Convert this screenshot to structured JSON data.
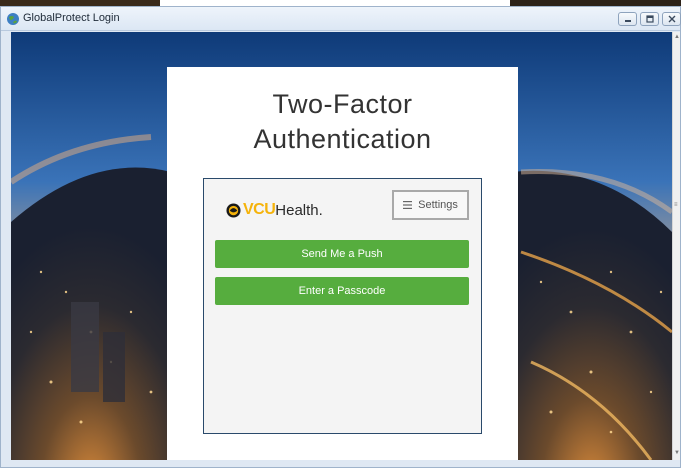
{
  "window": {
    "title": "GlobalProtect Login",
    "app_icon": "globe-icon",
    "controls": [
      "minimize-icon",
      "maximize-icon",
      "close-icon"
    ]
  },
  "login": {
    "heading_line1": "Two-Factor",
    "heading_line2": "Authentication"
  },
  "duo": {
    "logo_primary": "VCU",
    "logo_secondary": "Health.",
    "logo_color": "#f5b30b",
    "settings_label": "Settings",
    "settings_icon": "menu-icon",
    "push_label": "Send Me a Push",
    "passcode_label": "Enter a Passcode",
    "button_color": "#56ad3e"
  }
}
